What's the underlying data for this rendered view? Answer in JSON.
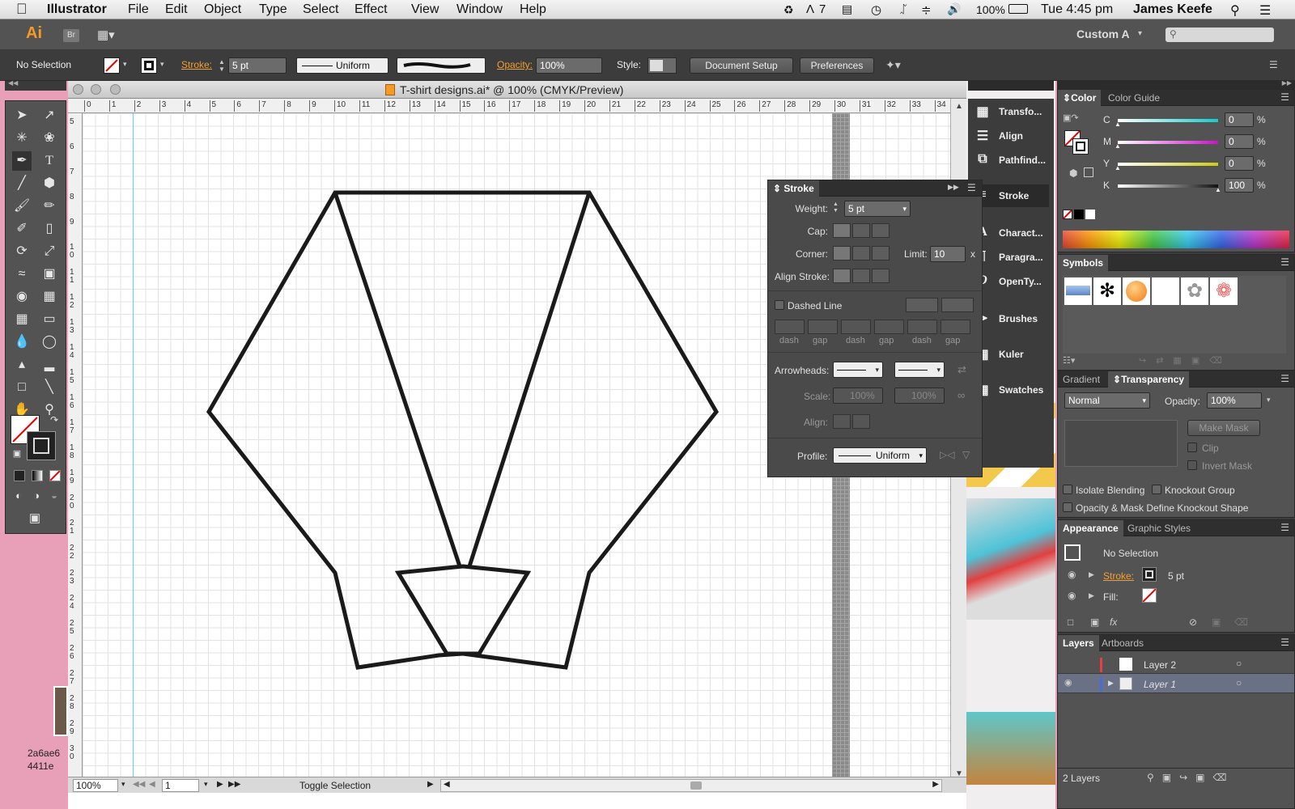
{
  "menubar": {
    "app": "Illustrator",
    "items": [
      "File",
      "Edit",
      "Object",
      "Type",
      "Select",
      "Effect",
      "View",
      "Window",
      "Help"
    ],
    "battery": "100%",
    "time": "Tue 4:45 pm",
    "user": "James Keefe",
    "adobe_badge": "7"
  },
  "appbar": {
    "logo": "Ai",
    "bridge": "Br",
    "workspace": "Custom A",
    "search_placeholder": ""
  },
  "control": {
    "selection": "No Selection",
    "stroke_label": "Stroke:",
    "stroke_value": "5 pt",
    "profile": "Uniform",
    "opacity_label": "Opacity:",
    "opacity_value": "100%",
    "style_label": "Style:",
    "doc_setup": "Document Setup",
    "preferences": "Preferences"
  },
  "document": {
    "title": "T-shirt designs.ai* @ 100% (CMYK/Preview)",
    "ruler_top": [
      "0",
      "1",
      "2",
      "3",
      "4",
      "5",
      "6",
      "7",
      "8",
      "9",
      "10",
      "11",
      "12",
      "13",
      "14",
      "15",
      "16",
      "17",
      "18",
      "19",
      "20",
      "21",
      "22",
      "23",
      "24",
      "25",
      "26",
      "27",
      "28",
      "29",
      "30",
      "31",
      "32",
      "33",
      "34"
    ],
    "ruler_left": [
      "5",
      "6",
      "7",
      "8",
      "9",
      "1 0",
      "1 1",
      "1 2",
      "1 3",
      "1 4",
      "1 5",
      "1 6",
      "1 7",
      "1 8",
      "1 9",
      "2 0",
      "2 1",
      "2 2",
      "2 3",
      "2 4",
      "2 5",
      "2 6",
      "2 7",
      "2 8",
      "2 9",
      "3 0"
    ],
    "zoom": "100%",
    "artboard": "1",
    "status": "Toggle Selection"
  },
  "dock": [
    "Transfo...",
    "Align",
    "Pathfind...",
    "Stroke",
    "Charact...",
    "Paragra...",
    "OpenTy...",
    "Brushes",
    "Kuler",
    "Swatches"
  ],
  "stroke_panel": {
    "tab": "Stroke",
    "weight_label": "Weight:",
    "weight": "5 pt",
    "cap_label": "Cap:",
    "corner_label": "Corner:",
    "limit_label": "Limit:",
    "limit": "10",
    "limit_unit": "x",
    "align_label": "Align Stroke:",
    "dashed_label": "Dashed Line",
    "dash_labels": [
      "dash",
      "gap",
      "dash",
      "gap",
      "dash",
      "gap"
    ],
    "arrowheads_label": "Arrowheads:",
    "scale_label": "Scale:",
    "scale1": "100%",
    "scale2": "100%",
    "align2_label": "Align:",
    "profile_label": "Profile:",
    "profile": "Uniform"
  },
  "color_panel": {
    "tab": "Color",
    "tab2": "Color Guide",
    "channels": [
      {
        "name": "C",
        "value": "0",
        "unit": "%",
        "level": 0
      },
      {
        "name": "M",
        "value": "0",
        "unit": "%",
        "level": 0
      },
      {
        "name": "Y",
        "value": "0",
        "unit": "%",
        "level": 0
      },
      {
        "name": "K",
        "value": "100",
        "unit": "%",
        "level": 1
      }
    ]
  },
  "symbols_panel": {
    "tab": "Symbols"
  },
  "transparency_panel": {
    "tab1": "Gradient",
    "tab2": "Transparency",
    "mode": "Normal",
    "opacity_label": "Opacity:",
    "opacity": "100%",
    "make_mask": "Make Mask",
    "clip": "Clip",
    "invert": "Invert Mask",
    "isolate": "Isolate Blending",
    "knockout": "Knockout Group",
    "opacity_mask": "Opacity & Mask Define Knockout Shape"
  },
  "appearance_panel": {
    "tab1": "Appearance",
    "tab2": "Graphic Styles",
    "title": "No Selection",
    "stroke_label": "Stroke:",
    "stroke_value": "5 pt",
    "fill_label": "Fill:"
  },
  "layers_panel": {
    "tab1": "Layers",
    "tab2": "Artboards",
    "layers": [
      {
        "name": "Layer 2",
        "color": "#e84040"
      },
      {
        "name": "Layer 1",
        "color": "#4a6cd8"
      }
    ],
    "count": "2 Layers"
  },
  "desktop": {
    "file1": "2a6ae6",
    "file2": "4411e"
  }
}
